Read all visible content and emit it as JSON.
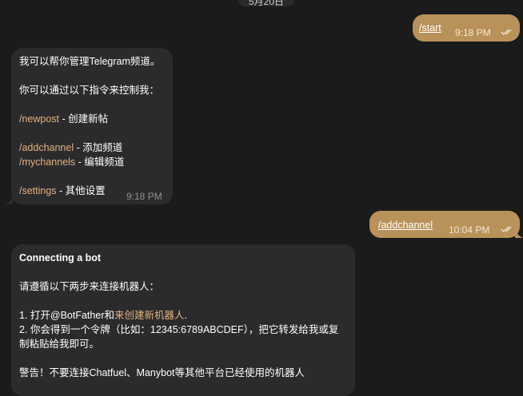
{
  "date_label": "5月20日",
  "messages": {
    "m1": {
      "text": "/start",
      "time": "9:18 PM"
    },
    "m2": {
      "line1": "我可以帮你管理Telegram频道。",
      "line2": "你可以通过以下指令来控制我：",
      "cmd1": "/newpost",
      "desc1": " - 创建新帖",
      "cmd2": "/addchannel",
      "desc2": " - 添加频道",
      "cmd3": "/mychannels",
      "desc3": " - 编辑频道",
      "cmd4": "/settings",
      "desc4": " - 其他设置",
      "time": "9:18 PM"
    },
    "m3": {
      "text": "/addchannel",
      "time": "10:04 PM"
    },
    "m4": {
      "title": "Connecting a bot",
      "line1": "请遵循以下两步来连接机器人：",
      "step1_prefix": "1. 打开@BotFather和",
      "step1_link": "来创建新机器人",
      "step1_suffix": ".",
      "step2_a": "2. 你会得到一个令牌（比如：12345:6789ABCDEF），把它转发给我或复",
      "step2_b": "制粘贴给我即可。",
      "warning": "警告！不要连接Chatfuel、Manybot等其他平台已经使用的机器人"
    }
  },
  "colors": {
    "background": "#1b1b1b",
    "outgoing_bubble": "#b9925a",
    "incoming_bubble": "#2b2b2d",
    "command": "#e3b27d"
  }
}
